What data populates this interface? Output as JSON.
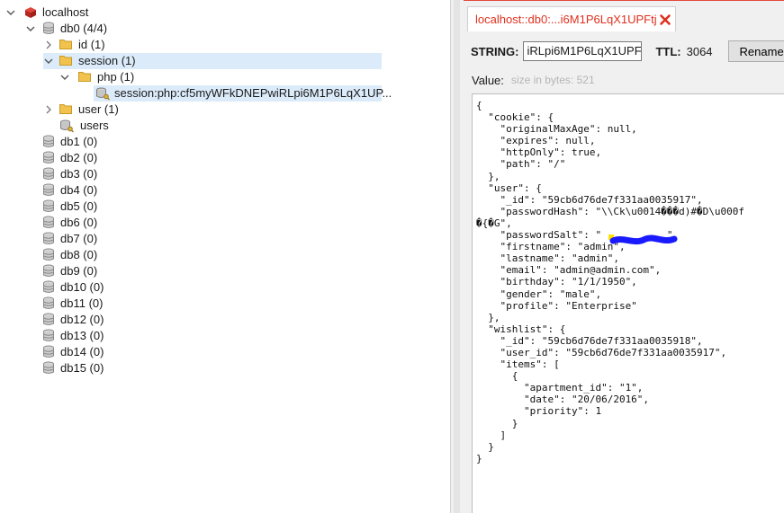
{
  "tree": {
    "root": {
      "label": "localhost"
    },
    "db0": {
      "label": "db0  (4/4)"
    },
    "id": {
      "label": "id (1)"
    },
    "session": {
      "label": "session (1)"
    },
    "php": {
      "label": "php (1)"
    },
    "session_key": {
      "label": "session:php:cf5myWFkDNEPwiRLpi6M1P6LqX1UP..."
    },
    "user": {
      "label": "user (1)"
    },
    "users": {
      "label": "users"
    },
    "databases": [
      {
        "label": "db1 (0)"
      },
      {
        "label": "db2 (0)"
      },
      {
        "label": "db3 (0)"
      },
      {
        "label": "db4 (0)"
      },
      {
        "label": "db5 (0)"
      },
      {
        "label": "db6 (0)"
      },
      {
        "label": "db7 (0)"
      },
      {
        "label": "db8 (0)"
      },
      {
        "label": "db9 (0)"
      },
      {
        "label": "db10 (0)"
      },
      {
        "label": "db11 (0)"
      },
      {
        "label": "db12 (0)"
      },
      {
        "label": "db13 (0)"
      },
      {
        "label": "db14 (0)"
      },
      {
        "label": "db15 (0)"
      }
    ]
  },
  "tab": {
    "title": "localhost::db0:...i6M1P6LqX1UPFtj",
    "close_icon": "close-icon"
  },
  "key_view": {
    "type_label": "STRING:",
    "key_value": "iRLpi6M1P6LqX1UPFtj",
    "ttl_label": "TTL:",
    "ttl_value": "3064",
    "rename_label": "Rename"
  },
  "value": {
    "label": "Value:",
    "size_text": "size in bytes: 521",
    "content": "{\n  \"cookie\": {\n    \"originalMaxAge\": null,\n    \"expires\": null,\n    \"httpOnly\": true,\n    \"path\": \"/\"\n  },\n  \"user\": {\n    \"_id\": \"59cb6d76de7f331aa0035917\",\n    \"passwordHash\": \"\\\\Ck\\u0014���d)#�D\\u000f\n�{�G\",\n    \"passwordSalt\": \"           \",\n    \"firstname\": \"admin\",\n    \"lastname\": \"admin\",\n    \"email\": \"admin@admin.com\",\n    \"birthday\": \"1/1/1950\",\n    \"gender\": \"male\",\n    \"profile\": \"Enterprise\"\n  },\n  \"wishlist\": {\n    \"_id\": \"59cb6d76de7f331aa0035918\",\n    \"user_id\": \"59cb6d76de7f331aa0035917\",\n    \"items\": [\n      {\n        \"apartment_id\": \"1\",\n        \"date\": \"20/06/2016\",\n        \"priority\": 1\n      }\n    ]\n  }\n}"
  },
  "colors": {
    "accent": "#e0301e",
    "selection": "#dcebfa",
    "folder": "#f2c24f",
    "redaction": "#1a1aff"
  }
}
